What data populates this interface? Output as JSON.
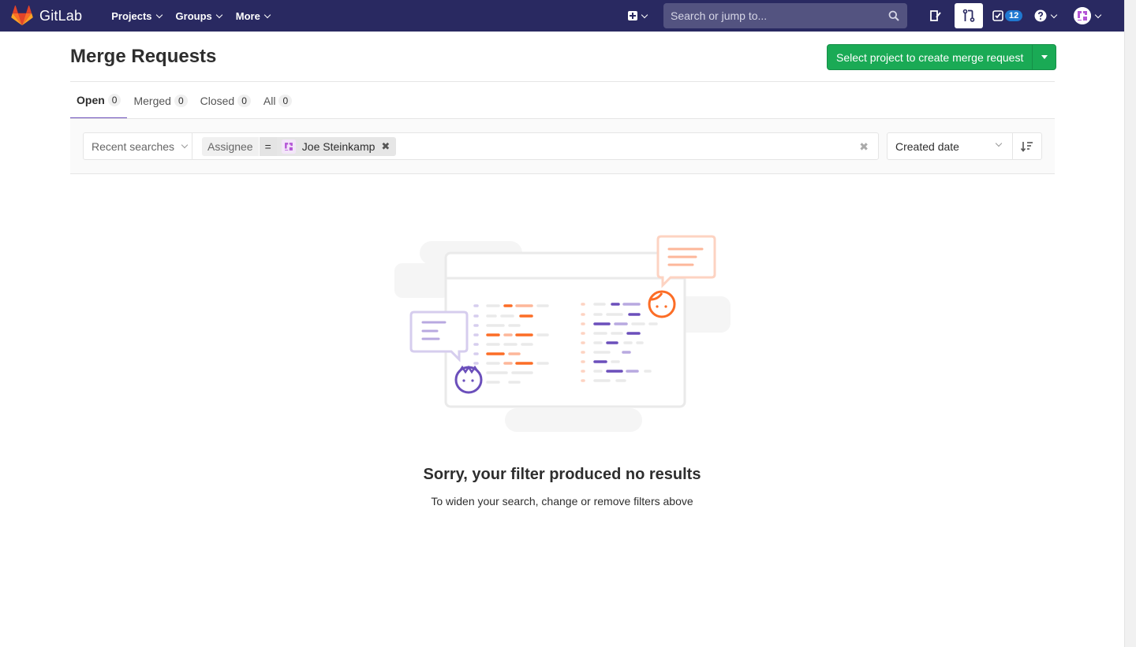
{
  "navbar": {
    "app_name": "GitLab",
    "menu": [
      {
        "label": "Projects"
      },
      {
        "label": "Groups"
      },
      {
        "label": "More"
      }
    ],
    "search_placeholder": "Search or jump to...",
    "todos_count": "12"
  },
  "page": {
    "title": "Merge Requests",
    "create_button": "Select project to create merge request"
  },
  "tabs": [
    {
      "label": "Open",
      "count": "0",
      "active": true
    },
    {
      "label": "Merged",
      "count": "0"
    },
    {
      "label": "Closed",
      "count": "0"
    },
    {
      "label": "All",
      "count": "0"
    }
  ],
  "filter": {
    "recent_searches": "Recent searches",
    "token_name": "Assignee",
    "token_operator": "=",
    "token_value": "Joe Steinkamp",
    "sort_by": "Created date"
  },
  "empty_state": {
    "title": "Sorry, your filter produced no results",
    "subtitle": "To widen your search, change or remove filters above"
  },
  "colors": {
    "navbar": "#292961",
    "primary_button": "#1aaa55",
    "active_tab_underline": "#6b4fbb"
  }
}
